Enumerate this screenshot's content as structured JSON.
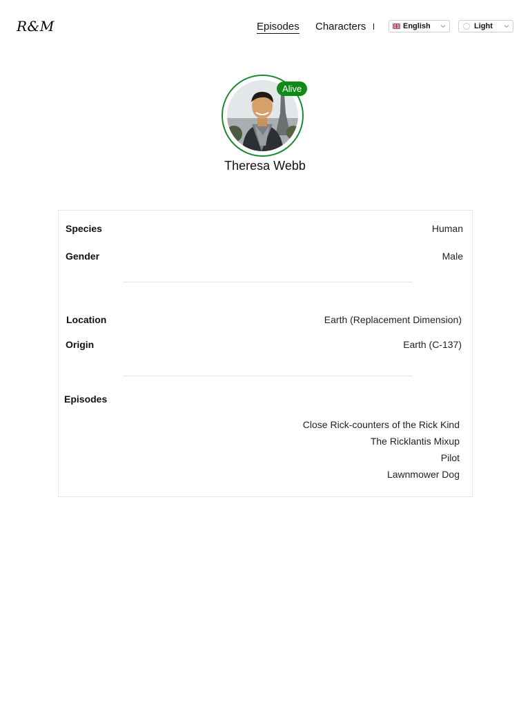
{
  "header": {
    "logo": "R&M",
    "nav": {
      "episodes": "Episodes",
      "characters": "Characters"
    },
    "language": {
      "selected": "English",
      "icon": "uk-flag-icon"
    },
    "theme": {
      "selected": "Light",
      "icon": "circle-icon"
    }
  },
  "character": {
    "name": "Theresa Webb",
    "status": "Alive",
    "status_color": "#0f8a17",
    "fields": {
      "species": {
        "label": "Species",
        "value": "Human"
      },
      "gender": {
        "label": "Gender",
        "value": "Male"
      },
      "location": {
        "label": "Location",
        "value": "Earth (Replacement Dimension)"
      },
      "origin": {
        "label": "Origin",
        "value": "Earth (C-137)"
      }
    },
    "episodes_label": "Episodes",
    "episodes": [
      "Close Rick-counters of the Rick Kind",
      "The Ricklantis Mixup",
      "Pilot",
      "Lawnmower Dog"
    ]
  }
}
